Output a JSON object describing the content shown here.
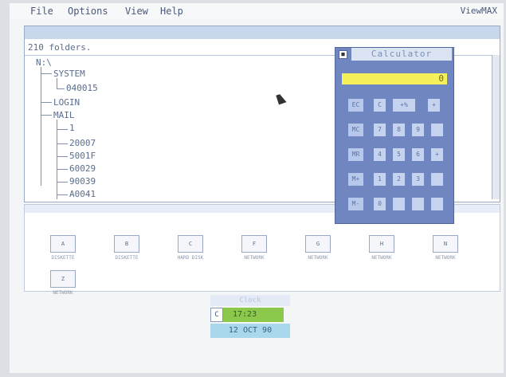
{
  "menubar": {
    "items": [
      "File",
      "Options",
      "View",
      "Help"
    ],
    "brand": "ViewMAX"
  },
  "tree_window": {
    "title": "",
    "folder_count": "210 folders.",
    "nodes": [
      "N:\\",
      "SYSTEM",
      "040015",
      "LOGIN",
      "MAIL",
      "1",
      "20007",
      "5001F",
      "60029",
      "90039",
      "A0041"
    ]
  },
  "calculator": {
    "title": "Calculator",
    "display": "0",
    "rows": [
      [
        "EC",
        "C",
        "+%",
        "+"
      ],
      [
        "MC",
        "7",
        "8",
        "9",
        ""
      ],
      [
        "MR",
        "4",
        "5",
        "6",
        "+"
      ],
      [
        "M+",
        "1",
        "2",
        "3",
        ""
      ],
      [
        "M-",
        "0",
        "",
        "",
        ""
      ]
    ]
  },
  "drives": [
    {
      "label": "DISKETTE"
    },
    {
      "label": "DISKETTE"
    },
    {
      "label": "HARD DISK"
    },
    {
      "label": "NETWORK"
    },
    {
      "label": "NETWORK"
    },
    {
      "label": "NETWORK"
    },
    {
      "label": "NETWORK"
    },
    {
      "label": "NETWORK"
    }
  ],
  "clock": {
    "title": "Clock",
    "c_button": "C",
    "time": "17:23",
    "date": "12 OCT 90"
  },
  "colors": {
    "accent": "#6f86c0",
    "display": "#f6f05a",
    "time_bg": "#8cc84b",
    "date_bg": "#a9d8ec"
  }
}
